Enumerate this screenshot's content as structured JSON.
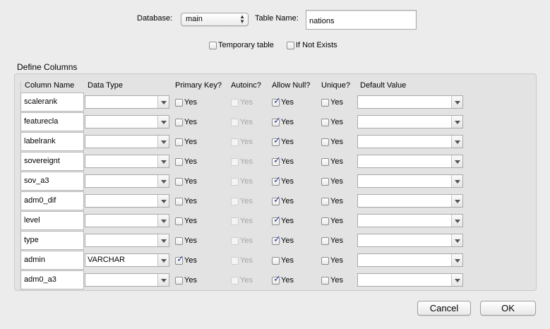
{
  "header": {
    "database_label": "Database:",
    "database_value": "main",
    "table_name_label": "Table Name:",
    "table_name_value": "nations",
    "temporary_label": "Temporary table",
    "temporary_checked": false,
    "if_not_exists_label": "If Not Exists",
    "if_not_exists_checked": false
  },
  "columns_group": {
    "title": "Define Columns",
    "headers": {
      "column_name": "Column Name",
      "data_type": "Data Type",
      "primary_key": "Primary Key?",
      "autoinc": "Autoinc?",
      "allow_null": "Allow Null?",
      "unique": "Unique?",
      "default_value": "Default Value"
    },
    "yes_label": "Yes",
    "rows": [
      {
        "name": "scalerank",
        "type": "",
        "primary_key": false,
        "autoinc": false,
        "allow_null": true,
        "unique": false,
        "default": ""
      },
      {
        "name": "featurecla",
        "type": "",
        "primary_key": false,
        "autoinc": false,
        "allow_null": true,
        "unique": false,
        "default": ""
      },
      {
        "name": "labelrank",
        "type": "",
        "primary_key": false,
        "autoinc": false,
        "allow_null": true,
        "unique": false,
        "default": ""
      },
      {
        "name": "sovereignt",
        "type": "",
        "primary_key": false,
        "autoinc": false,
        "allow_null": true,
        "unique": false,
        "default": ""
      },
      {
        "name": "sov_a3",
        "type": "",
        "primary_key": false,
        "autoinc": false,
        "allow_null": true,
        "unique": false,
        "default": ""
      },
      {
        "name": "adm0_dif",
        "type": "",
        "primary_key": false,
        "autoinc": false,
        "allow_null": true,
        "unique": false,
        "default": ""
      },
      {
        "name": "level",
        "type": "",
        "primary_key": false,
        "autoinc": false,
        "allow_null": true,
        "unique": false,
        "default": ""
      },
      {
        "name": "type",
        "type": "",
        "primary_key": false,
        "autoinc": false,
        "allow_null": true,
        "unique": false,
        "default": ""
      },
      {
        "name": "admin",
        "type": "VARCHAR",
        "primary_key": true,
        "autoinc": false,
        "allow_null": false,
        "unique": false,
        "default": ""
      },
      {
        "name": "adm0_a3",
        "type": "",
        "primary_key": false,
        "autoinc": false,
        "allow_null": true,
        "unique": false,
        "default": ""
      }
    ]
  },
  "buttons": {
    "cancel": "Cancel",
    "ok": "OK"
  },
  "colors": {
    "window_bg": "#ececec",
    "group_bg": "#e3e3e3",
    "checkmark": "#2c3f9a"
  }
}
